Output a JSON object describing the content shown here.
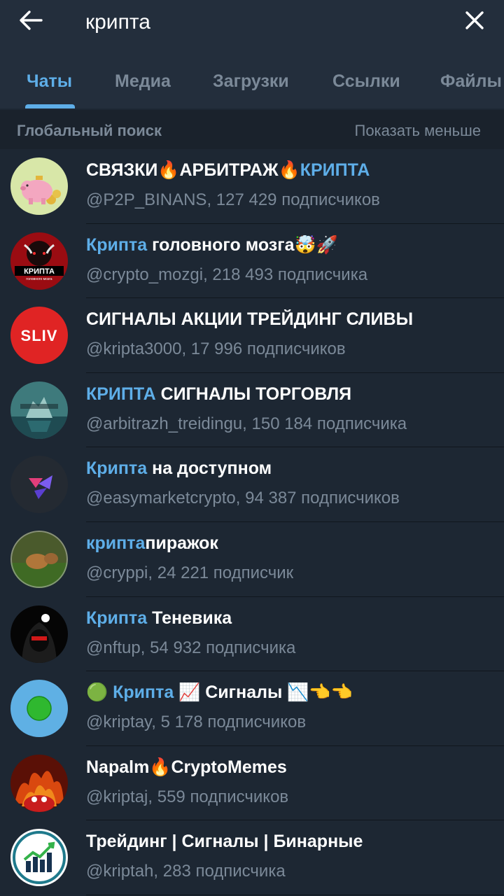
{
  "search": {
    "query": "крипта"
  },
  "tabs": [
    {
      "label": "Чаты",
      "active": true
    },
    {
      "label": "Медиа",
      "active": false
    },
    {
      "label": "Загрузки",
      "active": false
    },
    {
      "label": "Ссылки",
      "active": false
    },
    {
      "label": "Файлы",
      "active": false
    }
  ],
  "section": {
    "title": "Глобальный поиск",
    "action": "Показать меньше"
  },
  "results": [
    {
      "title_parts": [
        [
          "СВЯЗКИ",
          false
        ],
        [
          "🔥",
          false
        ],
        [
          "АРБИТРАЖ",
          false
        ],
        [
          "🔥",
          false
        ],
        [
          "КРИПТА",
          true
        ]
      ],
      "handle": "@P2P_BINANS",
      "subscribers": "127 429 подписчиков",
      "avatar": "piggy-bank"
    },
    {
      "title_parts": [
        [
          "Крипта",
          true
        ],
        [
          " головного мозга",
          false
        ],
        [
          "🤯🚀",
          false
        ]
      ],
      "handle": "@crypto_mozgi",
      "subscribers": "218 493 подписчика",
      "avatar": "bull"
    },
    {
      "title_parts": [
        [
          "СИГНАЛЫ АКЦИИ ТРЕЙДИНГ СЛИВЫ",
          false
        ]
      ],
      "handle": "@kripta3000",
      "subscribers": "17 996 подписчиков",
      "avatar": "sliv",
      "avatar_text": "SLIV"
    },
    {
      "title_parts": [
        [
          "КРИПТА",
          true
        ],
        [
          " СИГНАЛЫ ТОРГОВЛЯ",
          false
        ]
      ],
      "handle": "@arbitrazh_treidingu",
      "subscribers": "150 184 подписчика",
      "avatar": "iceberg"
    },
    {
      "title_parts": [
        [
          "Крипта",
          true
        ],
        [
          " на доступном",
          false
        ]
      ],
      "handle": "@easymarketcrypto",
      "subscribers": "94 387 подписчиков",
      "avatar": "triangles"
    },
    {
      "title_parts": [
        [
          "крипта",
          true
        ],
        [
          "пиражок",
          false
        ]
      ],
      "handle": "@cryppi",
      "subscribers": "24 221 подписчик",
      "avatar": "pie"
    },
    {
      "title_parts": [
        [
          "Крипта",
          true
        ],
        [
          " Теневика",
          false
        ]
      ],
      "handle": "@nftup",
      "subscribers": "54 932 подписчика",
      "avatar": "hooded"
    },
    {
      "title_parts": [
        [
          "🟢 ",
          false
        ],
        [
          "Крипта",
          true
        ],
        [
          " 📈 Сигналы 📉👈👈",
          false
        ]
      ],
      "handle": "@kriptay",
      "subscribers": "5 178 подписчиков",
      "avatar": "green-dot"
    },
    {
      "title_parts": [
        [
          "Napalm",
          false
        ],
        [
          "🔥",
          false
        ],
        [
          "CryptoMemes",
          false
        ]
      ],
      "handle": "@kriptaj",
      "subscribers": "559 подписчиков",
      "avatar": "fire"
    },
    {
      "title_parts": [
        [
          "Трейдинг | Сигналы | Бинарные",
          false
        ]
      ],
      "handle": "@kriptah",
      "subscribers": "283 подписчика",
      "avatar": "chart"
    }
  ],
  "colors": {
    "accent": "#5eaee8",
    "background": "#1d2733",
    "header": "#232e3c",
    "muted": "#7b8998"
  }
}
